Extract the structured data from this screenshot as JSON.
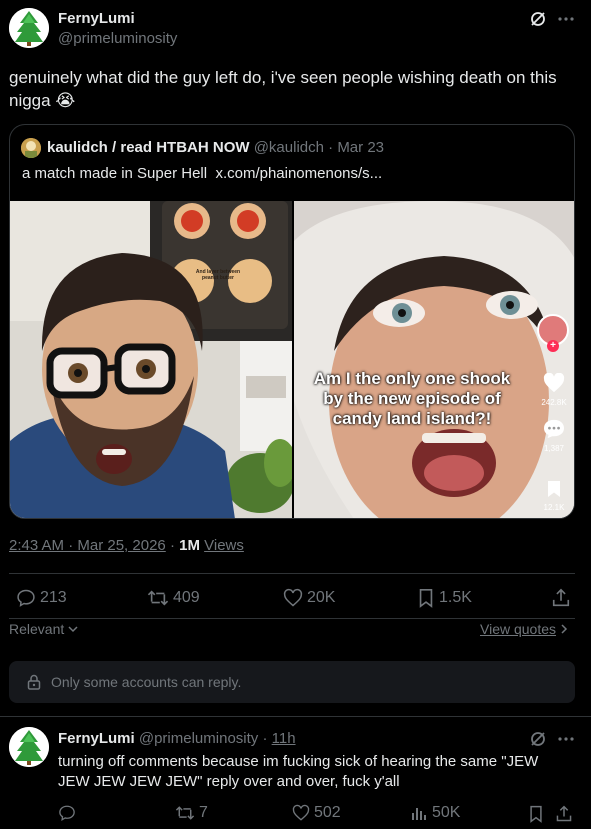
{
  "main_tweet": {
    "display_name": "FernyLumi",
    "handle": "@primeluminosity",
    "text": "genuinely what did the guy left do, i've seen people wishing death on this nigga",
    "emoji": "😭",
    "quote": {
      "display_name": "kaulidch / read HTBAH NOW",
      "handle": "@kaulidch",
      "sep": "·",
      "date": "Mar 23",
      "text": "a match made in Super Hell",
      "link": "x.com/phainomenons/s...",
      "left_image": {
        "tray_label": "And layer between peanut butter"
      },
      "right_image": {
        "caption": "Am I the only one shook by the new episode of candy land island?!",
        "likes": "242.8K",
        "comments": "1,387",
        "saves": "12.1K"
      }
    },
    "timestamp": "2:43 AM · Mar 25, 2026",
    "dot": "·",
    "views_count": "1M",
    "views_label": "Views",
    "stats": {
      "replies": "213",
      "reposts": "409",
      "likes": "20K",
      "bookmarks": "1.5K"
    },
    "sort_label": "Relevant",
    "view_quotes": "View quotes",
    "reply_restriction": "Only some accounts can reply."
  },
  "reply_tweet": {
    "display_name": "FernyLumi",
    "handle": "@primeluminosity",
    "sep": "·",
    "time": "11h",
    "text": "turning off comments because im fucking sick of hearing the same \"JEW JEW JEW JEW JEW\" reply over and over, fuck y'all",
    "stats": {
      "reposts": "7",
      "likes": "502",
      "views": "50K"
    }
  },
  "icons": [
    "tree-avatar",
    "grok-icon",
    "more-icon",
    "reply-icon",
    "repost-icon",
    "like-icon",
    "bookmark-icon",
    "share-icon",
    "lock-icon",
    "chevron-down-icon",
    "chevron-right-icon",
    "views-icon"
  ],
  "colors": {
    "background": "#000000",
    "text": "#e7e9ea",
    "dim": "#71767b",
    "border": "#2f3336",
    "restriction_bg": "#16181c"
  }
}
